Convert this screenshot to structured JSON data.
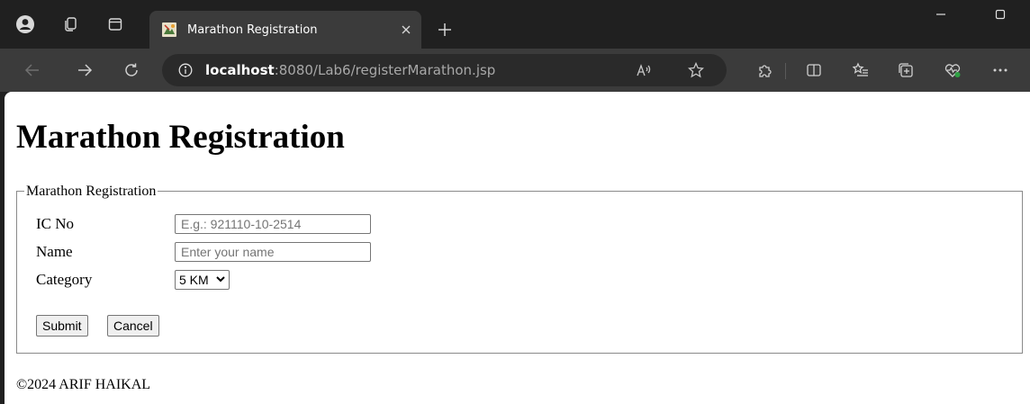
{
  "tab": {
    "title": "Marathon Registration"
  },
  "address": {
    "host": "localhost",
    "rest": ":8080/Lab6/registerMarathon.jsp"
  },
  "page": {
    "heading": "Marathon Registration",
    "legend": "Marathon Registration",
    "fields": [
      {
        "label": "IC No",
        "placeholder": "E.g.: 921110-10-2514",
        "value": ""
      },
      {
        "label": "Name",
        "placeholder": "Enter your name",
        "value": ""
      }
    ],
    "category": {
      "label": "Category",
      "selected": "5 KM"
    },
    "submit_label": "Submit",
    "cancel_label": "Cancel",
    "footer": "©2024 ARIF HAIKAL"
  },
  "colors": {
    "chrome_bg": "#202020",
    "toolbar_bg": "#3b3b3b",
    "omnibox_bg": "#2a2a2a",
    "accent_green": "#2ea043"
  },
  "icons": [
    "profile-icon",
    "workspaces-icon",
    "tab-actions-icon",
    "favicon",
    "close-icon",
    "plus-icon",
    "minimize-icon",
    "maximize-icon",
    "back-icon",
    "forward-icon",
    "refresh-icon",
    "info-icon",
    "read-aloud-icon",
    "favorite-star-icon",
    "extensions-icon",
    "split-screen-icon",
    "favorites-icon",
    "collections-icon",
    "browser-essentials-icon",
    "more-icon"
  ]
}
